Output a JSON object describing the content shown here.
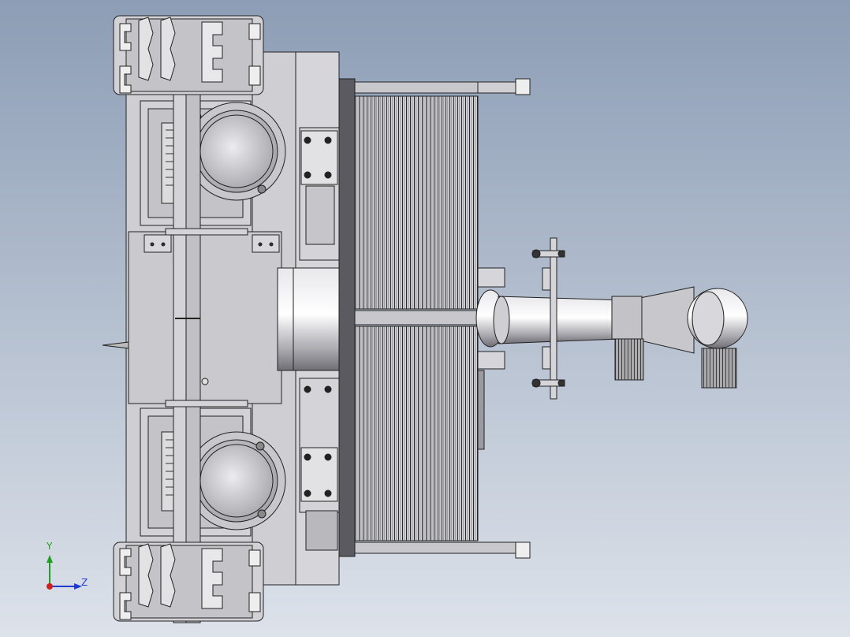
{
  "viewport": {
    "background_top": "#8c9db5",
    "background_bottom": "#dde2ea",
    "line_color": "#1a1a1a",
    "part_light": "#d8d8dc",
    "part_mid": "#c4c4c8",
    "part_dark": "#9a9aa0"
  },
  "triad": {
    "y_label": "Y",
    "z_label": "Z",
    "y_color": "#1fa01f",
    "z_color": "#1f3cd0",
    "x_color": "#d01f1f"
  }
}
